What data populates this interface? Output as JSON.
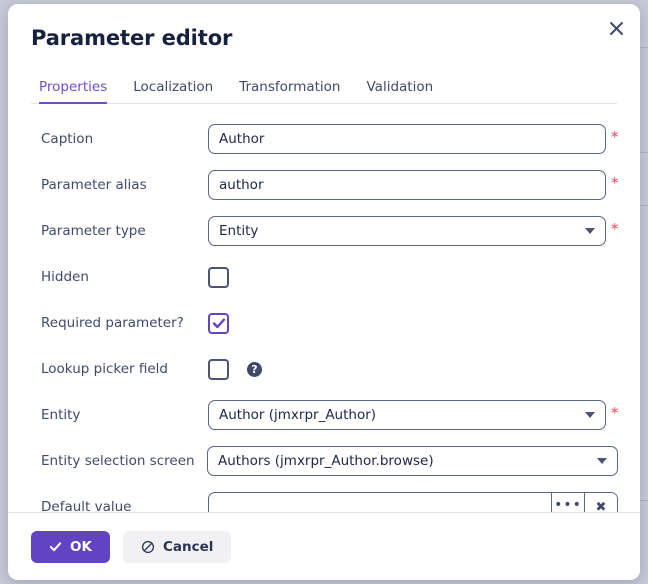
{
  "dialog": {
    "title": "Parameter editor",
    "close_icon": "close-icon"
  },
  "tabs": [
    {
      "label": "Properties",
      "active": true
    },
    {
      "label": "Localization",
      "active": false
    },
    {
      "label": "Transformation",
      "active": false
    },
    {
      "label": "Validation",
      "active": false
    }
  ],
  "form": {
    "caption": {
      "label": "Caption",
      "value": "Author",
      "placeholder": "",
      "required_marker": "*"
    },
    "parameter_alias": {
      "label": "Parameter alias",
      "value": "author",
      "placeholder": "",
      "required_marker": "*"
    },
    "parameter_type": {
      "label": "Parameter type",
      "value": "Entity",
      "required_marker": "*"
    },
    "hidden": {
      "label": "Hidden",
      "checked": false
    },
    "required_parameter": {
      "label": "Required parameter?",
      "checked": true
    },
    "lookup_picker_field": {
      "label": "Lookup picker field",
      "checked": false,
      "help_glyph": "?"
    },
    "entity": {
      "label": "Entity",
      "value": "Author (jmxrpr_Author)",
      "required_marker": "*"
    },
    "entity_selection_screen": {
      "label": "Entity selection screen",
      "value": "Authors (jmxrpr_Author.browse)"
    },
    "default_value": {
      "label": "Default value",
      "value": "",
      "placeholder": "",
      "browse_glyph": "•••",
      "clear_glyph": "✖"
    }
  },
  "footer": {
    "ok_label": "OK",
    "ok_icon": "check-icon",
    "cancel_label": "Cancel",
    "cancel_icon": "ban-icon"
  },
  "colors": {
    "accent": "#6243c4",
    "tab_active": "#6f4ec9",
    "required": "#e8455f",
    "label_text": "#3f4a6b",
    "title_text": "#17203f",
    "border": "#5a6687",
    "backdrop": "#c7cad8"
  }
}
